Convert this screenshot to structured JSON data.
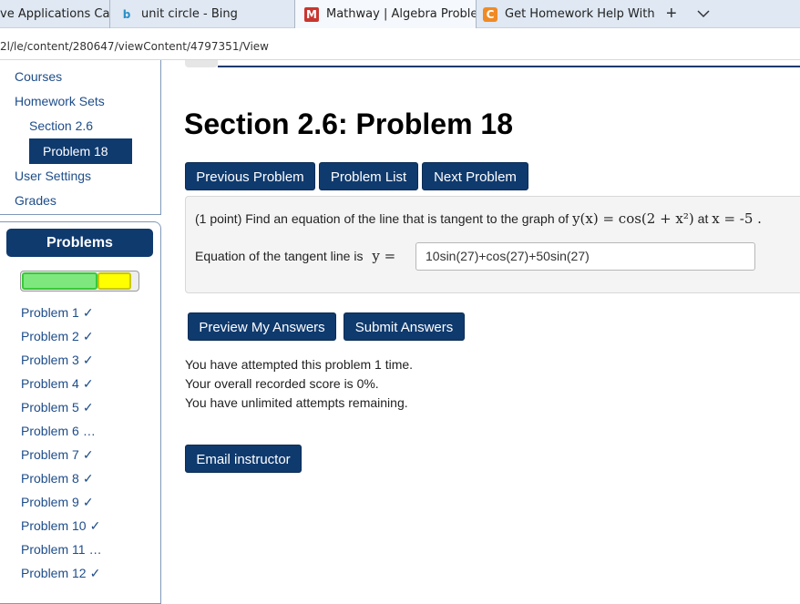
{
  "browser": {
    "tabs": [
      {
        "label": "ve Applications Calc",
        "icon": "none"
      },
      {
        "label": "unit circle - Bing",
        "icon": "bing-icon"
      },
      {
        "label": "Mathway | Algebra Problem",
        "icon": "mathway-icon"
      },
      {
        "label": "Get Homework Help With C",
        "icon": "chegg-icon"
      }
    ],
    "new_tab": "+",
    "url": "2l/le/content/280647/viewContent/4797351/View"
  },
  "nav": {
    "courses": "Courses",
    "homework_sets": "Homework Sets",
    "section": "Section 2.6",
    "problem": "Problem 18",
    "user_settings": "User Settings",
    "grades": "Grades"
  },
  "problems_panel": {
    "title": "Problems",
    "progress": {
      "correct_fraction": 0.65,
      "partial_fraction": 0.29,
      "correct_color": "#7ee87e",
      "partial_color": "#ffff00"
    },
    "items": [
      {
        "label": "Problem 1",
        "status": "✓"
      },
      {
        "label": "Problem 2",
        "status": "✓"
      },
      {
        "label": "Problem 3",
        "status": "✓"
      },
      {
        "label": "Problem 4",
        "status": "✓"
      },
      {
        "label": "Problem 5",
        "status": "✓"
      },
      {
        "label": "Problem 6",
        "status": "…"
      },
      {
        "label": "Problem 7",
        "status": "✓"
      },
      {
        "label": "Problem 8",
        "status": "✓"
      },
      {
        "label": "Problem 9",
        "status": "✓"
      },
      {
        "label": "Problem 10",
        "status": "✓"
      },
      {
        "label": "Problem 11",
        "status": "…"
      },
      {
        "label": "Problem 12",
        "status": "✓"
      }
    ]
  },
  "main": {
    "title": "Section 2.6: Problem 18",
    "buttons": {
      "previous": "Previous Problem",
      "list": "Problem List",
      "next": "Next Problem",
      "preview": "Preview My Answers",
      "submit": "Submit Answers",
      "email": "Email instructor"
    },
    "question": {
      "prefix": "(1 point) Find an equation of the line that is tangent to the graph of",
      "function": "y(x) = cos(2 + x²)",
      "at_label": "at",
      "point": "x = -5 .",
      "answer_label": "Equation of the tangent line is",
      "answer_var": "y =",
      "answer_value": "10sin(27)+cos(27)+50sin(27)"
    },
    "status_lines": [
      "You have attempted this problem 1 time.",
      "Your overall recorded score is 0%.",
      "You have unlimited attempts remaining."
    ]
  },
  "colors": {
    "primary": "#0f3a6e",
    "link": "#1e4d8a"
  }
}
